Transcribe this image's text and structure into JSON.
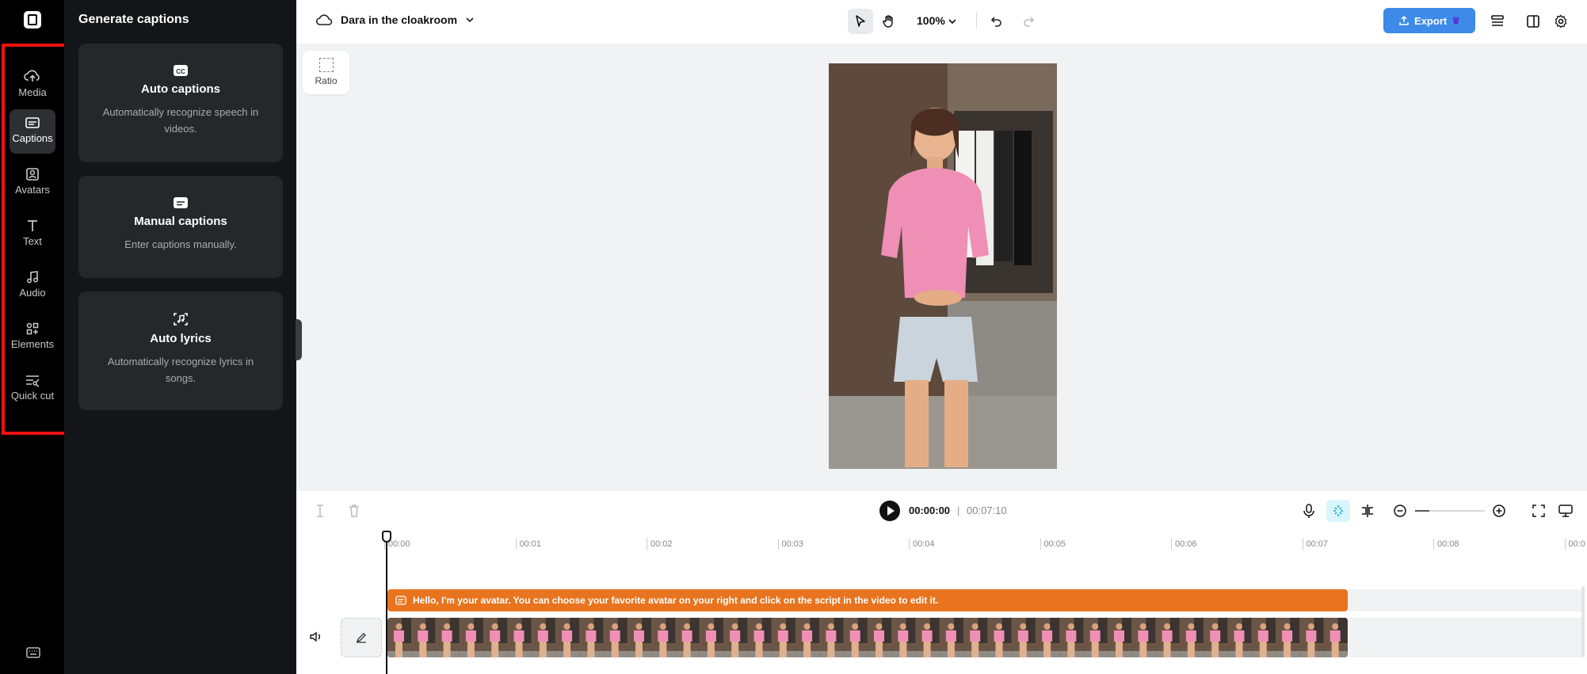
{
  "rail": {
    "items": [
      {
        "label": "Media",
        "icon": "cloud-upload-icon"
      },
      {
        "label": "Captions",
        "icon": "captions-icon",
        "active": true
      },
      {
        "label": "Avatars",
        "icon": "avatar-icon"
      },
      {
        "label": "Text",
        "icon": "text-icon"
      },
      {
        "label": "Audio",
        "icon": "music-note-icon"
      },
      {
        "label": "Elements",
        "icon": "elements-icon"
      },
      {
        "label": "Quick cut",
        "icon": "quick-cut-icon"
      }
    ],
    "highlight_color": "#ee1111"
  },
  "panel": {
    "title": "Generate captions",
    "cards": [
      {
        "title": "Auto captions",
        "desc": "Automatically recognize speech in videos.",
        "icon": "cc-icon"
      },
      {
        "title": "Manual captions",
        "desc": "Enter captions manually.",
        "icon": "subtitle-icon"
      },
      {
        "title": "Auto lyrics",
        "desc": "Automatically recognize lyrics in songs.",
        "icon": "lyrics-scan-icon"
      }
    ]
  },
  "topbar": {
    "project_name": "Dara in the cloakroom",
    "zoom": "100%",
    "export_label": "Export",
    "export_color": "#3d8ae8"
  },
  "canvas": {
    "ratio_label": "Ratio"
  },
  "controls": {
    "current_time": "00:00:00",
    "separator": "|",
    "total_time": "00:07:10",
    "zoom_level": 0.2
  },
  "timeline": {
    "ticks": [
      "00:00",
      "00:01",
      "00:02",
      "00:03",
      "00:04",
      "00:05",
      "00:06",
      "00:07",
      "00:08",
      "00:0"
    ],
    "caption_text": "Hello, I'm your avatar. You can choose your favorite avatar on your right and click on the script in the video to edit it.",
    "caption_color": "#e8741f"
  }
}
